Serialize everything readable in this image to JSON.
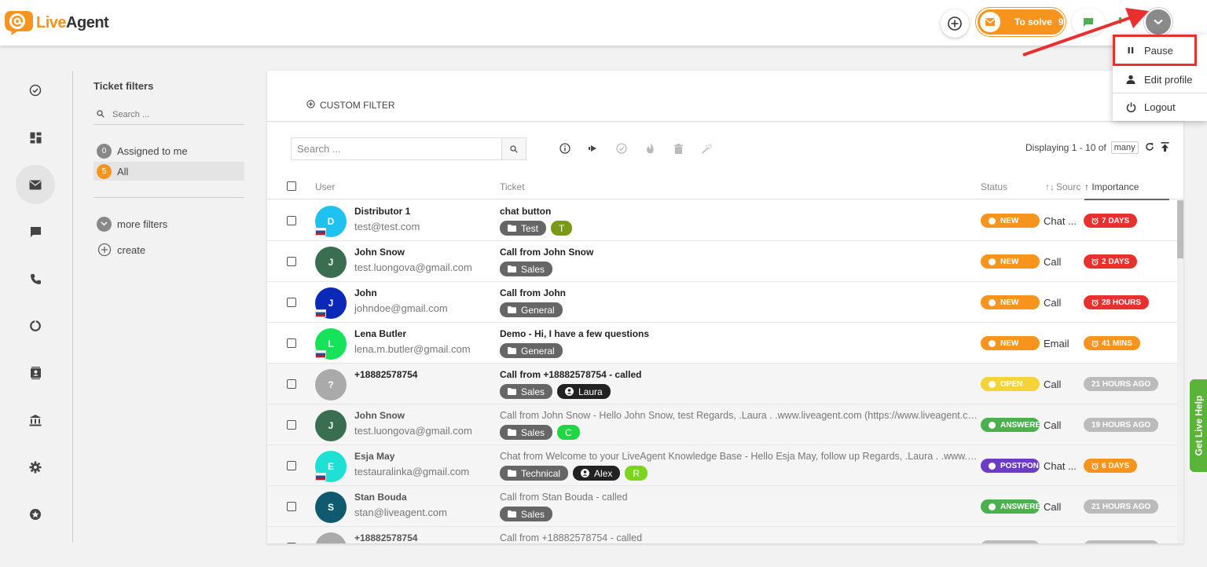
{
  "app": {
    "brand_live": "Live",
    "brand_agent": "Agent"
  },
  "header": {
    "to_solve_label": "To solve",
    "to_solve_count": "9"
  },
  "user_menu": {
    "items": [
      {
        "label": "Pause",
        "icon": "pause-icon"
      },
      {
        "label": "Edit profile",
        "icon": "person-icon"
      },
      {
        "label": "Logout",
        "icon": "power-icon"
      }
    ]
  },
  "filters": {
    "title": "Ticket filters",
    "search_placeholder": "Search ...",
    "items": [
      {
        "label": "Assigned to me",
        "count": "0"
      },
      {
        "label": "All",
        "count": "5"
      }
    ],
    "more": "more filters",
    "create": "create"
  },
  "main": {
    "custom_filter": "CUSTOM FILTER",
    "search_placeholder": "Search ...",
    "displaying": "Displaying 1 - 10 of",
    "many": "many",
    "columns": {
      "user": "User",
      "ticket": "Ticket",
      "status": "Status",
      "source": "Sourc",
      "importance": "Importance"
    }
  },
  "tickets": [
    {
      "initial": "D",
      "avatar_color": "#1fc2ef",
      "name": "Distributor 1",
      "email": "test@test.com",
      "subject": "chat button",
      "bold": true,
      "tags": [
        {
          "label": "Test",
          "color": "#666666",
          "icon": "folder"
        },
        {
          "label": "T",
          "color": "#7a9a13"
        }
      ],
      "status": "NEW",
      "status_color": "#f7941d",
      "source": "Chat ...",
      "importance": "7 DAYS",
      "imp_color": "#e8302f",
      "flag": true
    },
    {
      "initial": "J",
      "avatar_color": "#3a6e50",
      "name": "John Snow",
      "email": "test.luongova@gmail.com",
      "subject": "Call from John Snow",
      "bold": true,
      "tags": [
        {
          "label": "Sales",
          "color": "#666666",
          "icon": "folder"
        }
      ],
      "status": "NEW",
      "status_color": "#f7941d",
      "source": "Call",
      "importance": "2 DAYS",
      "imp_color": "#e8302f",
      "flag": false
    },
    {
      "initial": "J",
      "avatar_color": "#0b29b8",
      "name": "John",
      "email": "johndoe@gmail.com",
      "subject": "Call from John",
      "bold": true,
      "tags": [
        {
          "label": "General",
          "color": "#666666",
          "icon": "folder"
        }
      ],
      "status": "NEW",
      "status_color": "#f7941d",
      "source": "Call",
      "importance": "28 HOURS",
      "imp_color": "#e8302f",
      "flag": true
    },
    {
      "initial": "L",
      "avatar_color": "#16e35a",
      "name": "Lena Butler",
      "email": "lena.m.butler@gmail.com",
      "subject": "Demo - Hi, I have a few questions",
      "bold": true,
      "tags": [
        {
          "label": "General",
          "color": "#666666",
          "icon": "folder"
        }
      ],
      "status": "NEW",
      "status_color": "#f7941d",
      "source": "Email",
      "importance": "41 MINS",
      "imp_color": "#f7941d",
      "flag": true
    },
    {
      "initial": "?",
      "avatar_color": "#aaaaaa",
      "name": "+18882578754",
      "email": "",
      "subject": "Call from +18882578754 - called",
      "bold": true,
      "tags": [
        {
          "label": "Sales",
          "color": "#666666",
          "icon": "folder"
        },
        {
          "label": "Laura",
          "color": "#222222",
          "icon": "person"
        }
      ],
      "status": "OPEN",
      "status_color": "#f5d33a",
      "source": "Call",
      "importance": "21 HOURS AGO",
      "imp_color": "#bbbbbb",
      "flag": false
    },
    {
      "initial": "J",
      "avatar_color": "#3a6e50",
      "name": "John Snow",
      "email": "test.luongova@gmail.com",
      "subject": "Call from John Snow - Hello John Snow, test Regards, .Laura . .www.liveagent.com (https://www.liveagent.com)",
      "bold": false,
      "tags": [
        {
          "label": "Sales",
          "color": "#666666",
          "icon": "folder"
        },
        {
          "label": "C",
          "color": "#1dd842"
        }
      ],
      "status": "ANSWERED",
      "status_color": "#4caf50",
      "source": "Call",
      "importance": "19 HOURS AGO",
      "imp_color": "#bbbbbb",
      "flag": false
    },
    {
      "initial": "E",
      "avatar_color": "#1ee0d5",
      "name": "Esja May",
      "email": "testauralinka@gmail.com",
      "subject": "Chat from Welcome to your LiveAgent Knowledge Base - Hello Esja May, follow up Regards, .Laura . .www.liveagent.com",
      "bold": false,
      "tags": [
        {
          "label": "Technical",
          "color": "#666666",
          "icon": "folder"
        },
        {
          "label": "Alex",
          "color": "#222222",
          "icon": "person"
        },
        {
          "label": "R",
          "color": "#7bd61b"
        }
      ],
      "status": "POSTPONED",
      "status_color": "#6c3dc4",
      "source": "Chat ...",
      "importance": "6 DAYS",
      "imp_color": "#f7941d",
      "flag": true
    },
    {
      "initial": "S",
      "avatar_color": "#0f5a6e",
      "name": "Stan Bouda",
      "email": "stan@liveagent.com",
      "subject": "Call from Stan Bouda - called",
      "bold": false,
      "tags": [
        {
          "label": "Sales",
          "color": "#666666",
          "icon": "folder"
        }
      ],
      "status": "ANSWERED",
      "status_color": "#4caf50",
      "source": "Call",
      "importance": "21 HOURS AGO",
      "imp_color": "#bbbbbb",
      "flag": false
    },
    {
      "initial": "?",
      "avatar_color": "#aaaaaa",
      "name": "+18882578754",
      "email": "",
      "subject": "Call from +18882578754 - called",
      "bold": false,
      "tags": [],
      "status": "",
      "status_color": "#bbbbbb",
      "source": "",
      "importance": "",
      "imp_color": "#bbbbbb",
      "flag": false
    }
  ],
  "live_help": "Get Live Help",
  "colors": {
    "accent": "#f7941d",
    "alert": "#e8302f",
    "green": "#5bb33a"
  }
}
